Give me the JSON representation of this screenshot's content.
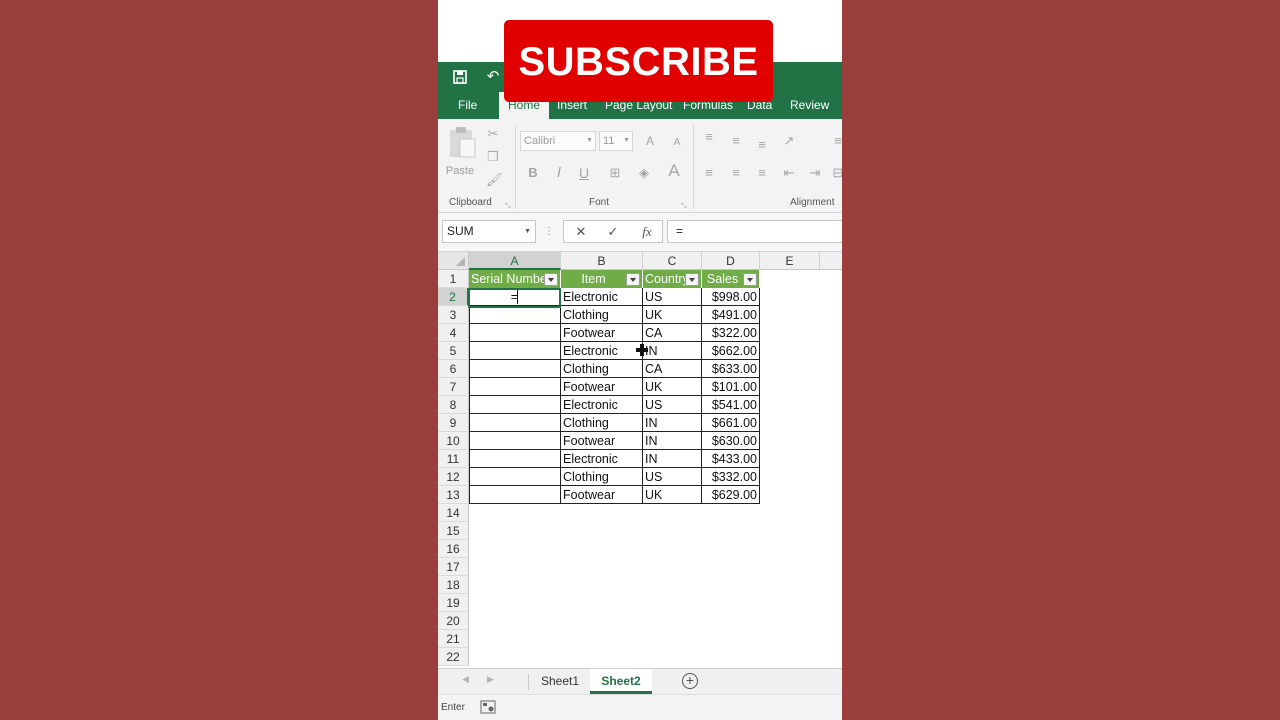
{
  "subscribe": {
    "label": "SUBSCRIBE"
  },
  "ribbon": {
    "tabs": [
      {
        "label": "File",
        "active": false
      },
      {
        "label": "Home",
        "active": true
      },
      {
        "label": "Insert",
        "active": false
      },
      {
        "label": "Page Layout",
        "active": false
      },
      {
        "label": "Formulas",
        "active": false
      },
      {
        "label": "Data",
        "active": false
      },
      {
        "label": "Review",
        "active": false
      }
    ],
    "clipboard": {
      "paste_label": "Paste",
      "group_label": "Clipboard"
    },
    "font": {
      "font_name": "Calibri",
      "font_size": "11",
      "group_label": "Font",
      "bold": "B",
      "italic": "I",
      "underline": "U",
      "font_color": "A",
      "grow": "A",
      "shrink": "A"
    },
    "alignment": {
      "group_label": "Alignment"
    }
  },
  "formula_bar": {
    "name_box": "SUM",
    "cancel_glyph": "✕",
    "enter_glyph": "✓",
    "fx_label": "fx",
    "formula": "="
  },
  "grid": {
    "columns": [
      "A",
      "B",
      "C",
      "D",
      "E"
    ],
    "rows": [
      "1",
      "2",
      "3",
      "4",
      "5",
      "6",
      "7",
      "8",
      "9",
      "10",
      "11",
      "12",
      "13",
      "14",
      "15",
      "16",
      "17",
      "18",
      "19",
      "20",
      "21",
      "22"
    ],
    "headers": [
      "Serial Number",
      "Item",
      "Country",
      "Sales"
    ],
    "active_cell_value": "=",
    "data": [
      {
        "item": "Electronic",
        "country": "US",
        "sales": "$998.00"
      },
      {
        "item": "Clothing",
        "country": "UK",
        "sales": "$491.00"
      },
      {
        "item": "Footwear",
        "country": "CA",
        "sales": "$322.00"
      },
      {
        "item": "Electronic",
        "country": "IN",
        "sales": "$662.00"
      },
      {
        "item": "Clothing",
        "country": "CA",
        "sales": "$633.00"
      },
      {
        "item": "Footwear",
        "country": "UK",
        "sales": "$101.00"
      },
      {
        "item": "Electronic",
        "country": "US",
        "sales": "$541.00"
      },
      {
        "item": "Clothing",
        "country": "IN",
        "sales": "$661.00"
      },
      {
        "item": "Footwear",
        "country": "IN",
        "sales": "$630.00"
      },
      {
        "item": "Electronic",
        "country": "IN",
        "sales": "$433.00"
      },
      {
        "item": "Clothing",
        "country": "US",
        "sales": "$332.00"
      },
      {
        "item": "Footwear",
        "country": "UK",
        "sales": "$629.00"
      }
    ]
  },
  "sheets": [
    {
      "label": "Sheet1",
      "active": false
    },
    {
      "label": "Sheet2",
      "active": true
    }
  ],
  "status": {
    "mode": "Enter"
  },
  "colors": {
    "excel_green": "#217346",
    "table_header": "#70ad47",
    "subscribe_red": "#e00000",
    "background": "#993f3c"
  }
}
